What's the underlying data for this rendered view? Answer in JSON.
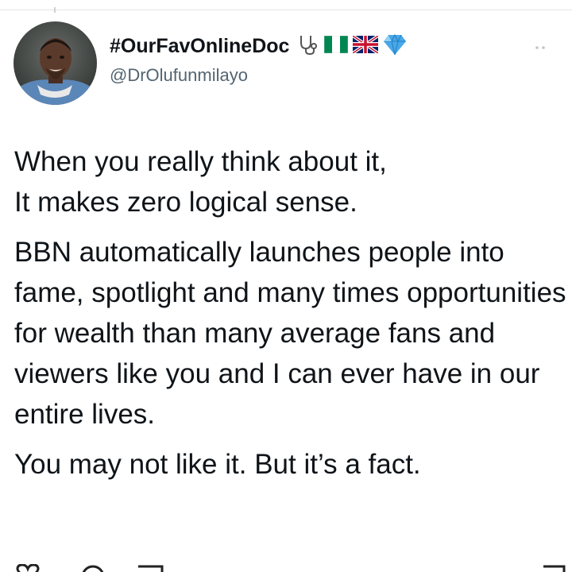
{
  "tweet": {
    "display_name": "#OurFavOnlineDoc",
    "handle": "@DrOlufunmilayo",
    "name_emojis": [
      "stethoscope-icon",
      "nigeria-flag-icon",
      "uk-flag-icon",
      "gem-icon"
    ],
    "body": {
      "p1_line1": "When you really think about it,",
      "p1_line2": "It makes zero logical sense.",
      "p2": "BBN automatically launches people into fame, spotlight and many times opportunities for wealth than many average fans and viewers like you and I can ever have in our entire lives.",
      "p3": "You may not like it. But it’s a fact."
    },
    "actions": [
      "like-icon",
      "reply-icon",
      "retweet-icon",
      "share-icon"
    ]
  },
  "colors": {
    "text": "#0f1419",
    "secondary_text": "#536471",
    "nigeria_green": "#008751",
    "uk_blue": "#012169",
    "uk_red": "#c8102e",
    "gem_blue": "#4aa8e8"
  }
}
